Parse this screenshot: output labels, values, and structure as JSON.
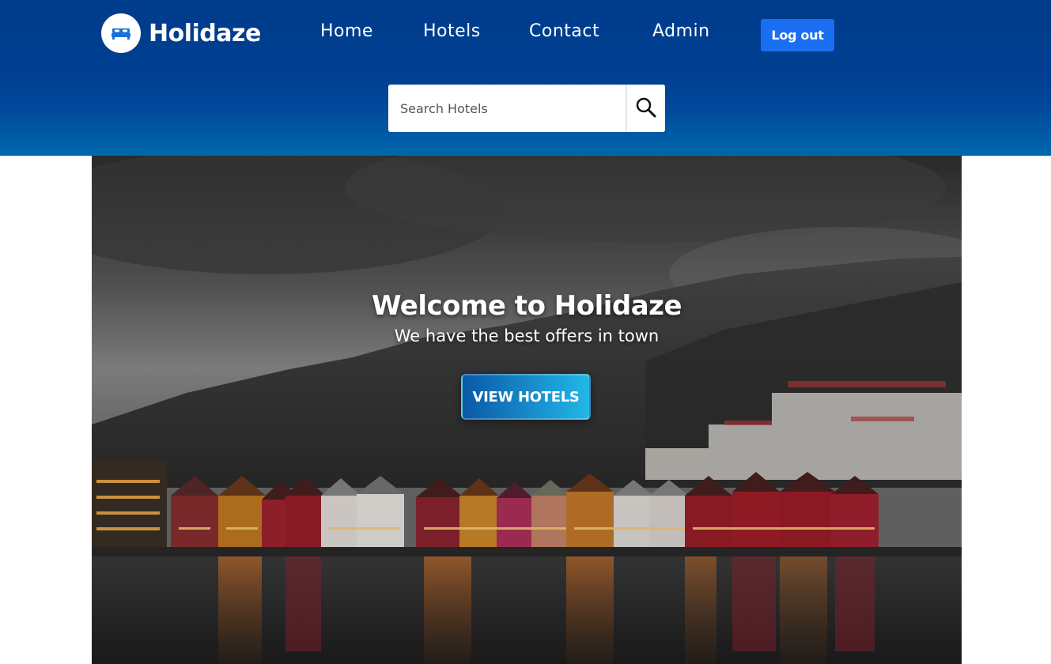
{
  "brand": {
    "name": "Holidaze",
    "icon": "bed-icon"
  },
  "nav": {
    "items": [
      {
        "label": "Home"
      },
      {
        "label": "Hotels"
      },
      {
        "label": "Contact"
      },
      {
        "label": "Admin"
      }
    ],
    "logout_label": "Log out"
  },
  "search": {
    "placeholder": "Search Hotels",
    "button_icon": "search-icon"
  },
  "hero": {
    "title": "Welcome to Holidaze",
    "subtitle": "We have the best offers in town",
    "cta_label": "VIEW HOTELS"
  },
  "colors": {
    "header_top": "#003c8c",
    "header_bottom": "#0068ad",
    "logout_button": "#1a6ef2",
    "cta_start": "#0a59a6",
    "cta_end": "#22b8e6"
  }
}
